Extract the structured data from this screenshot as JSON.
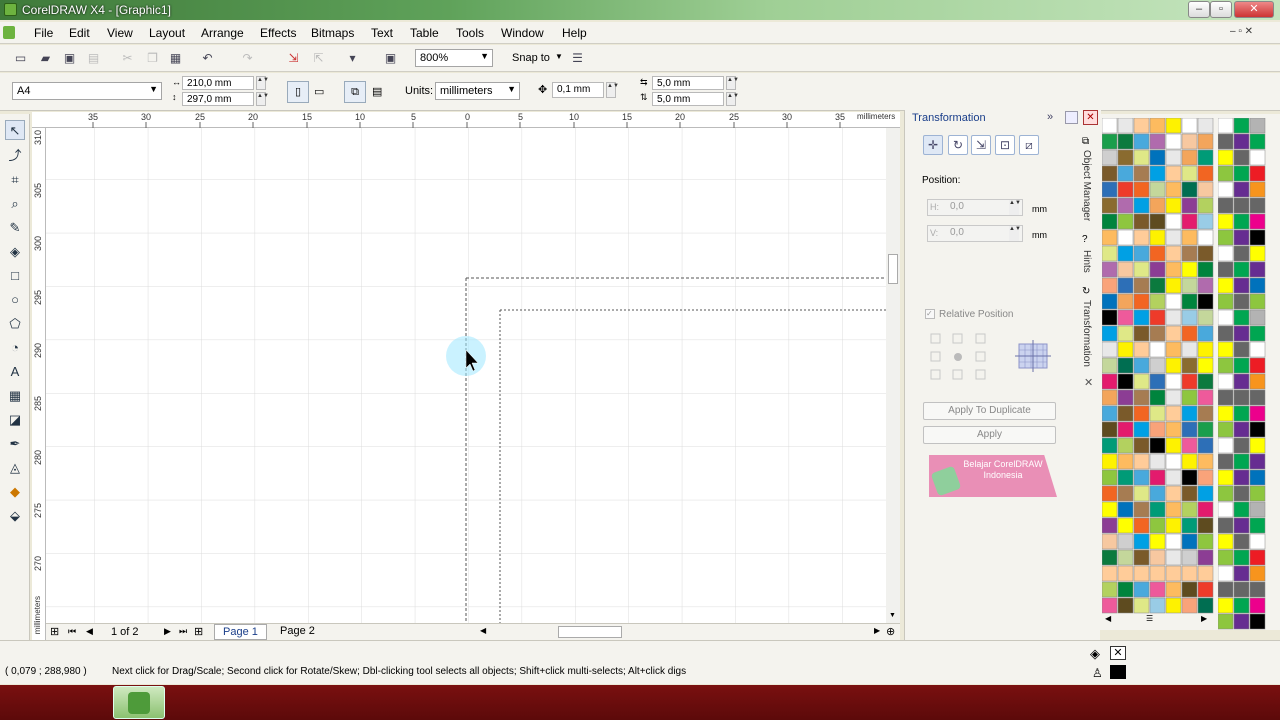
{
  "window": {
    "title": "CorelDRAW X4 - [Graphic1]"
  },
  "menu": [
    "File",
    "Edit",
    "View",
    "Layout",
    "Arrange",
    "Effects",
    "Bitmaps",
    "Text",
    "Table",
    "Tools",
    "Window",
    "Help"
  ],
  "toolbar": {
    "zoom": "800%",
    "snap_to": "Snap to"
  },
  "propbar": {
    "paper": "A4",
    "width": "210,0 mm",
    "height": "297,0 mm",
    "units_label": "Units:",
    "units": "millimeters",
    "nudge": "0,1 mm",
    "dup_x": "5,0 mm",
    "dup_y": "5,0 mm"
  },
  "rulers": {
    "h_labels": [
      "35",
      "30",
      "25",
      "20",
      "15",
      "10",
      "5",
      "0",
      "5",
      "10",
      "15",
      "20",
      "25",
      "30",
      "35"
    ],
    "h_unit": "millimeters",
    "v_labels": [
      "310",
      "305",
      "300",
      "295",
      "290",
      "285",
      "280",
      "275",
      "270"
    ],
    "v_unit": "millimeters"
  },
  "pages": {
    "counter": "1 of 2",
    "tabs": [
      "Page 1",
      "Page 2"
    ]
  },
  "docker": {
    "title": "Transformation",
    "position_label": "Position:",
    "h_label": "H:",
    "h_value": "0,0",
    "v_label": "V:",
    "v_value": "0,0",
    "unit": "mm",
    "relative_position": "Relative Position",
    "apply_duplicate": "Apply To Duplicate",
    "apply": "Apply",
    "watermark": "Belajar CorelDRAW Indonesia"
  },
  "vertical_tabs": [
    "Object Manager",
    "Hints",
    "Transformation"
  ],
  "status": {
    "coords": "( 0,079 ; 288,980 )",
    "message": "Next click for Drag/Scale; Second click for Rotate/Skew; Dbl-clicking tool selects all objects; Shift+click multi-selects; Alt+click digs"
  },
  "colors": {
    "palette1": [
      "#ffffff",
      "#000000",
      "#ffff00",
      "#1a9e4b",
      "#00a0e4",
      "#8c3d94",
      "#cfcfcf",
      "#e8e8e8",
      "#f7c8a0",
      "#7a5a2a",
      "#c4d79b",
      "#0b7a3e",
      "#2d6fb7",
      "#e31b6d",
      "#ffcc99",
      "#8a6b2f",
      "#f3a55b",
      "#b3d15f",
      "#00843d",
      "#49a9dc",
      "#ee5a9b",
      "#fdbb5f",
      "#5e4b1f",
      "#ee3b2a",
      "#dfe887",
      "#009b77",
      "#99cce6",
      "#b06bad",
      "#fef200",
      "#a67c52",
      "#f9a37a",
      "#8ec63f",
      "#006e51",
      "#0072bc",
      "#f26522"
    ],
    "palette2": [
      "#ffffff",
      "#000000",
      "#b3b3b3",
      "#666666",
      "#0072bc",
      "#ed1c24",
      "#ffff00",
      "#00a651",
      "#ec008c",
      "#8dc63f",
      "#f7941d",
      "#662d91"
    ]
  }
}
